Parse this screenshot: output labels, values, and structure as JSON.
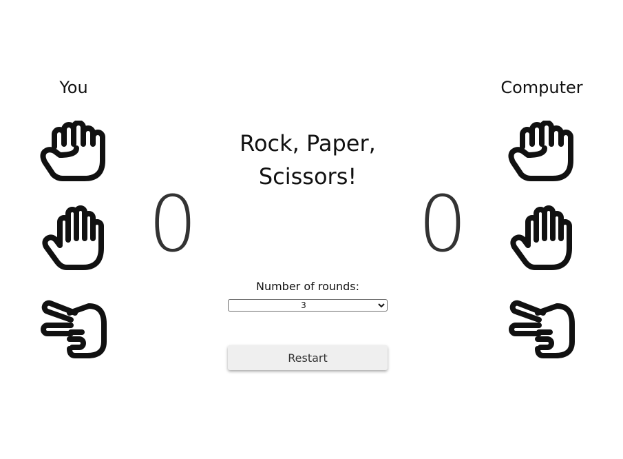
{
  "players": {
    "you_label": "You",
    "computer_label": "Computer"
  },
  "scores": {
    "you": "0",
    "computer": "0"
  },
  "title": {
    "line1": "Rock, Paper,",
    "line2": "Scissors!"
  },
  "rounds": {
    "label": "Number of rounds:",
    "selected": "3"
  },
  "restart": {
    "label": "Restart"
  },
  "icons": {
    "rock": "fist-icon",
    "paper": "open-hand-icon",
    "scissors": "scissors-hand-icon"
  },
  "colors": {
    "icon_stroke": "#111111",
    "score": "#333333",
    "button_bg": "#efefef"
  }
}
